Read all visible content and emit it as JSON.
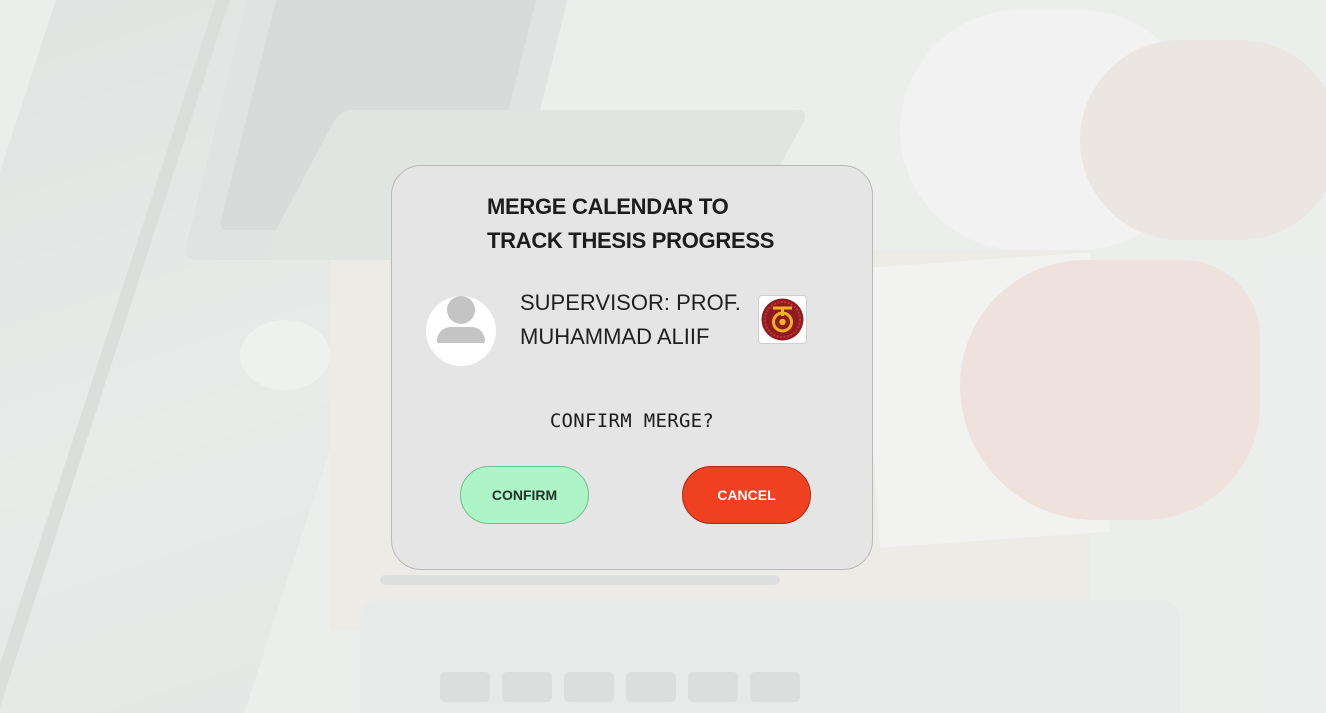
{
  "dialog": {
    "title_line1": "MERGE CALENDAR TO",
    "title_line2": "TRACK THESIS PROGRESS",
    "supervisor_line1": "SUPERVISOR: PROF.",
    "supervisor_line2": "MUHAMMAD ALIIF",
    "avatar_icon": "user-placeholder-icon",
    "logo_icon": "university-logo",
    "prompt": "CONFIRM MERGE?",
    "confirm_label": "CONFIRM",
    "cancel_label": "CANCEL"
  },
  "colors": {
    "dialog_bg": "#e5e5e5",
    "confirm_bg": "#adf5c7",
    "cancel_bg": "#ef4120",
    "logo_maroon": "#8f1b1f",
    "logo_gold": "#f0b323"
  }
}
